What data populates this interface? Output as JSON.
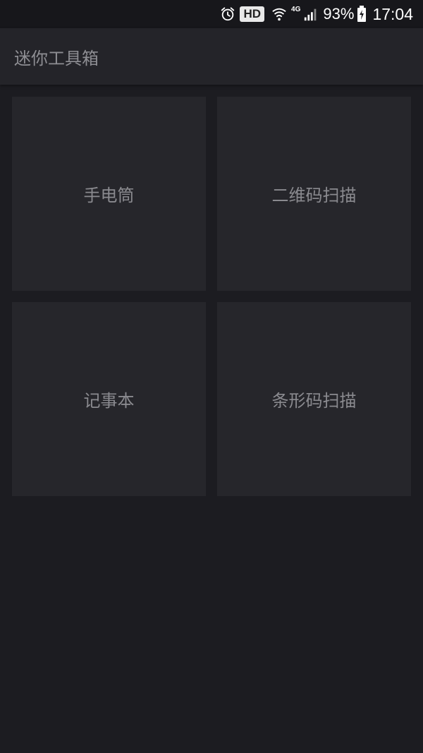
{
  "status_bar": {
    "hd_label": "HD",
    "network_label": "4G",
    "battery_percent": "93%",
    "time": "17:04",
    "icons": [
      "alarm-icon",
      "wifi-icon",
      "signal-icon",
      "battery-charging-icon"
    ]
  },
  "app_bar": {
    "title": "迷你工具箱"
  },
  "tools": [
    {
      "label": "手电筒"
    },
    {
      "label": "二维码扫描"
    },
    {
      "label": "记事本"
    },
    {
      "label": "条形码扫描"
    }
  ],
  "colors": {
    "background": "#1c1c21",
    "app_bar": "#242429",
    "tile": "#26262b",
    "text": "#8a8a8f"
  }
}
